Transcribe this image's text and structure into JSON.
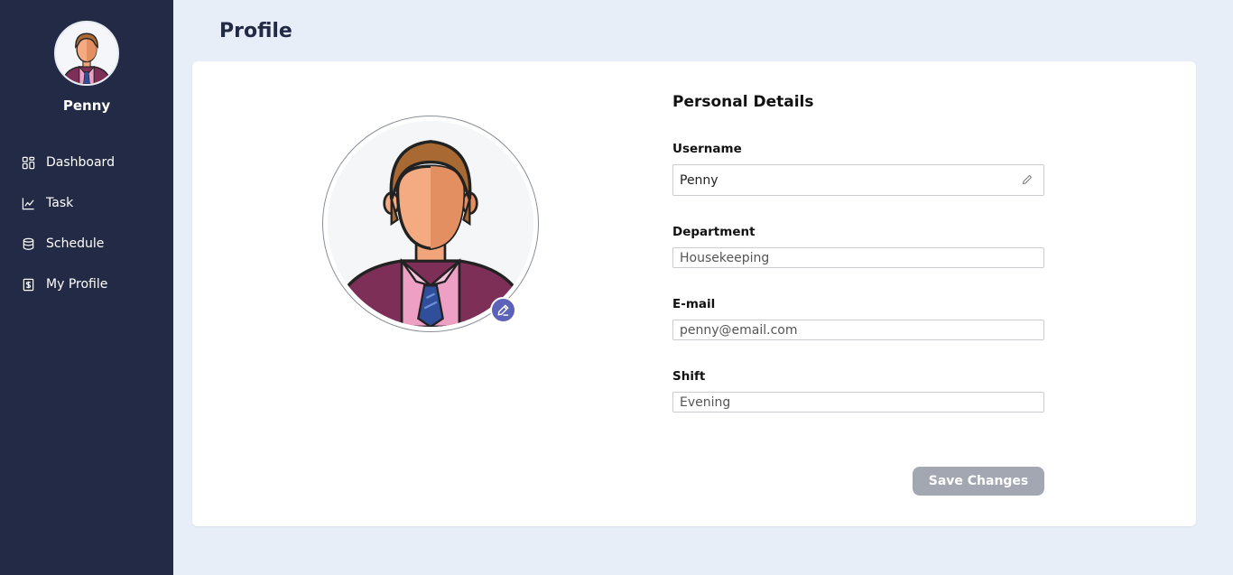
{
  "sidebar": {
    "user_name": "Penny",
    "items": [
      {
        "label": "Dashboard",
        "icon": "dashboard-icon"
      },
      {
        "label": "Task",
        "icon": "chart-icon"
      },
      {
        "label": "Schedule",
        "icon": "database-icon"
      },
      {
        "label": "My Profile",
        "icon": "profile-file-icon"
      }
    ]
  },
  "header": {
    "title": "Profile"
  },
  "details": {
    "title": "Personal Details",
    "username": {
      "label": "Username",
      "value": "Penny"
    },
    "department": {
      "label": "Department",
      "value": "Housekeeping"
    },
    "email": {
      "label": "E-mail",
      "value": "penny@email.com"
    },
    "shift": {
      "label": "Shift",
      "value": "Evening"
    },
    "save_label": "Save Changes"
  },
  "colors": {
    "sidebar_bg": "#232a45",
    "page_bg": "#e7eef8",
    "accent": "#5b62b8",
    "button_disabled": "#a3a7b1"
  }
}
